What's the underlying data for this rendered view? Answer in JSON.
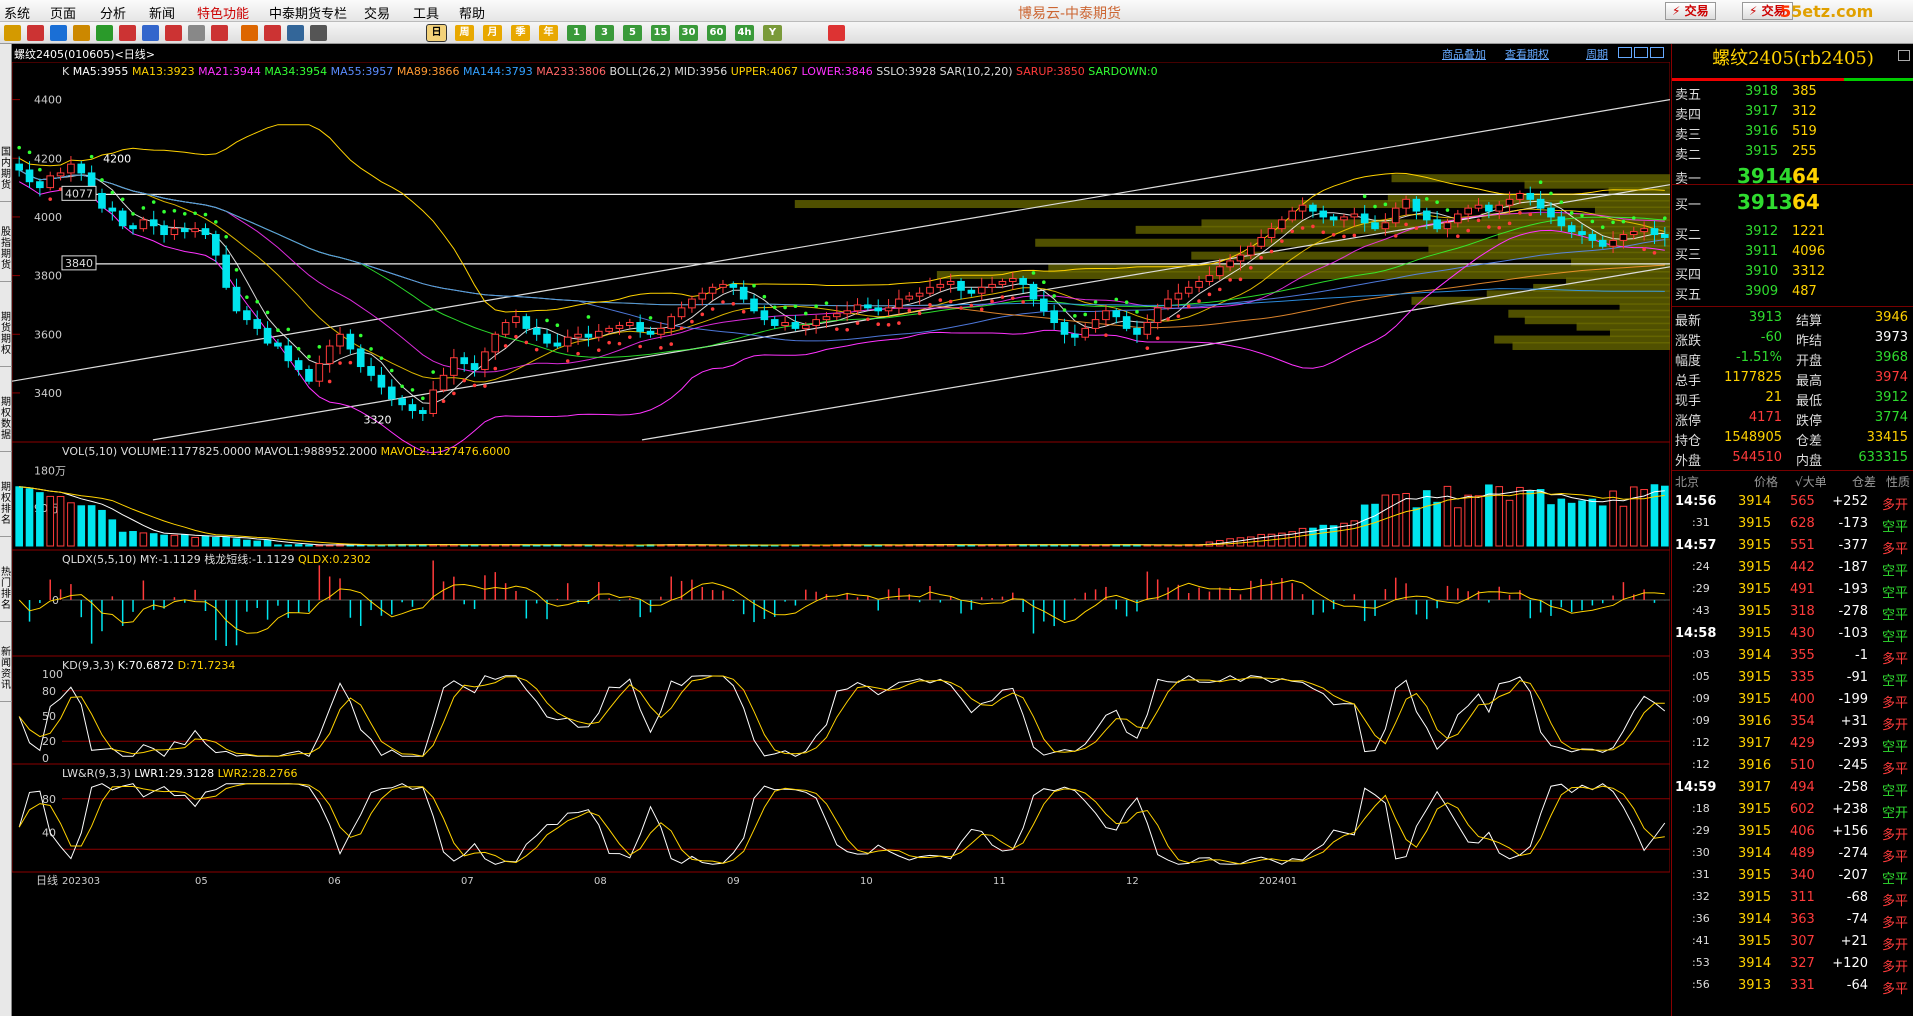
{
  "menu": {
    "items": [
      "系统",
      "页面",
      "分析",
      "新闻",
      "特色功能",
      "中泰期货专栏",
      "交易",
      "工具",
      "帮助"
    ],
    "app_title": "博易云-中泰期货",
    "trade_button": "交易",
    "trade_button2": "交易",
    "watermark_a": "5",
    "watermark_b": "5etz.com"
  },
  "toolbar": {
    "periods": [
      "日",
      "周",
      "月",
      "季",
      "年",
      "1",
      "3",
      "5",
      "15",
      "30",
      "60",
      "4h",
      "Y"
    ],
    "selected_period": "日"
  },
  "sidebar": {
    "tabs": [
      "国内期货",
      "股指期货",
      "期货期权",
      "期权数据",
      "期权排名",
      "热门排名",
      "新闻资讯"
    ]
  },
  "chart_header": {
    "symbol": "螺纹2405(010605)<日线>",
    "links": [
      "商品叠加",
      "查看期权",
      "周期"
    ]
  },
  "chart_data": [
    {
      "type": "candlestick",
      "panel": "main",
      "label": "K",
      "indicators": [
        {
          "name": "MA5",
          "value": "3955",
          "color": "#ffffff"
        },
        {
          "name": "MA13",
          "value": "3923",
          "color": "#ffd200"
        },
        {
          "name": "MA21",
          "value": "3944",
          "color": "#ff33ff"
        },
        {
          "name": "MA34",
          "value": "3954",
          "color": "#33ff33"
        },
        {
          "name": "MA55",
          "value": "3957",
          "color": "#5b8cff"
        },
        {
          "name": "MA89",
          "value": "3866",
          "color": "#ff9933"
        },
        {
          "name": "MA144",
          "value": "3793",
          "color": "#33a0ff"
        },
        {
          "name": "MA233",
          "value": "3806",
          "color": "#ff6666"
        },
        {
          "name": "BOLL(26,2)",
          "value": "",
          "color": "#dddddd"
        },
        {
          "name": "MID",
          "value": "3956",
          "color": "#dddddd"
        },
        {
          "name": "UPPER",
          "value": "4067",
          "color": "#ffd200"
        },
        {
          "name": "LOWER",
          "value": "3846",
          "color": "#ff33ff"
        },
        {
          "name": "SSLO",
          "value": "3928",
          "color": "#dddddd"
        },
        {
          "name": "SAR(10,2,20)",
          "value": "",
          "color": "#dddddd"
        },
        {
          "name": "SARUP",
          "value": "3850",
          "color": "#ff3b3b"
        },
        {
          "name": "SARDOWN",
          "value": "0",
          "color": "#33ff33"
        }
      ],
      "ylim": [
        3260,
        4460
      ],
      "y_ticks": [
        3400,
        3600,
        3800,
        4000,
        4200,
        4400
      ],
      "hlines": [
        4077,
        3840
      ],
      "annotations": [
        {
          "text": "4200",
          "x": 0.02,
          "y": 4200
        },
        {
          "text": "3320",
          "x": 0.177,
          "y": 3310
        },
        {
          "text": "4077",
          "x": 0.0,
          "y": 4077
        },
        {
          "text": "3840",
          "x": 0.0,
          "y": 3840
        }
      ],
      "closes": [
        4160,
        4120,
        4100,
        4140,
        4150,
        4180,
        4150,
        4080,
        4030,
        4020,
        3970,
        3960,
        3990,
        3970,
        3940,
        3960,
        3950,
        3960,
        3940,
        3870,
        3760,
        3680,
        3650,
        3620,
        3570,
        3560,
        3510,
        3480,
        3440,
        3500,
        3560,
        3600,
        3550,
        3490,
        3460,
        3420,
        3380,
        3360,
        3340,
        3330,
        3410,
        3460,
        3520,
        3500,
        3480,
        3540,
        3600,
        3640,
        3660,
        3620,
        3600,
        3570,
        3560,
        3590,
        3600,
        3590,
        3610,
        3620,
        3630,
        3640,
        3610,
        3600,
        3620,
        3660,
        3690,
        3720,
        3740,
        3760,
        3770,
        3760,
        3720,
        3680,
        3650,
        3630,
        3640,
        3620,
        3630,
        3650,
        3660,
        3670,
        3680,
        3700,
        3690,
        3680,
        3690,
        3720,
        3730,
        3740,
        3760,
        3770,
        3780,
        3750,
        3740,
        3760,
        3770,
        3780,
        3790,
        3770,
        3720,
        3680,
        3640,
        3600,
        3590,
        3620,
        3650,
        3680,
        3660,
        3620,
        3600,
        3640,
        3690,
        3720,
        3740,
        3760,
        3780,
        3800,
        3830,
        3850,
        3870,
        3900,
        3930,
        3960,
        3990,
        4020,
        4040,
        4020,
        4000,
        3990,
        4000,
        4010,
        3980,
        3960,
        3980,
        4030,
        4060,
        4020,
        3990,
        3960,
        3980,
        4010,
        4030,
        4040,
        4020,
        4040,
        4060,
        4080,
        4060,
        4030,
        4000,
        3970,
        3950,
        3940,
        3920,
        3900,
        3920,
        3940,
        3950,
        3960,
        3940,
        3930
      ],
      "channel_lines": [
        {
          "from": [
            0.0,
            3440
          ],
          "to": [
            1.0,
            4400
          ]
        },
        {
          "from": [
            0.085,
            3240
          ],
          "to": [
            1.0,
            4110
          ]
        },
        {
          "from": [
            0.38,
            3240
          ],
          "to": [
            1.0,
            3830
          ]
        }
      ]
    },
    {
      "type": "bar",
      "panel": "volume",
      "label": "VOL(5,10)",
      "indicators": [
        {
          "name": "VOLUME",
          "value": "1177825.0000",
          "color": "#dddddd"
        },
        {
          "name": "MAVOL1",
          "value": "988952.2000",
          "color": "#dddddd"
        },
        {
          "name": "MAVOL2",
          "value": "1127476.6000",
          "color": "#ffd200"
        }
      ],
      "y_ticks": [
        "180万",
        "90万"
      ],
      "ylim": [
        0,
        2000000
      ]
    },
    {
      "type": "macd",
      "panel": "qldx",
      "label": "QLDX(5,5,10)",
      "indicators": [
        {
          "name": "MY",
          "value": "-1.1129",
          "color": "#dddddd"
        },
        {
          "name": "栈龙短线",
          "value": "-1.1129",
          "color": "#dddddd"
        },
        {
          "name": "QLDX",
          "value": "0.2302",
          "color": "#ffd200"
        }
      ],
      "y_ticks": [
        "0"
      ]
    },
    {
      "type": "line",
      "panel": "kd",
      "label": "KD(9,3,3)",
      "indicators": [
        {
          "name": "K",
          "value": "70.6872",
          "color": "#ffffff"
        },
        {
          "name": "D",
          "value": "71.7234",
          "color": "#ffd200"
        }
      ],
      "ylim": [
        0,
        100
      ],
      "y_ticks": [
        0,
        20,
        50,
        80,
        100
      ]
    },
    {
      "type": "line",
      "panel": "lwr",
      "label": "LW&R(9,3,3)",
      "indicators": [
        {
          "name": "LWR1",
          "value": "29.3128",
          "color": "#ffffff"
        },
        {
          "name": "LWR2",
          "value": "28.2766",
          "color": "#ffd200"
        }
      ],
      "ylim": [
        0,
        100
      ],
      "y_ticks": [
        40,
        80
      ]
    }
  ],
  "x_axis": {
    "label": "日线",
    "ticks": [
      "202303",
      "05",
      "06",
      "07",
      "08",
      "09",
      "10",
      "11",
      "12",
      "202401"
    ]
  },
  "quote": {
    "title": "螺纹2405(rb2405)",
    "asks": [
      {
        "label": "卖五",
        "price": "3918",
        "vol": "385"
      },
      {
        "label": "卖四",
        "price": "3917",
        "vol": "312"
      },
      {
        "label": "卖三",
        "price": "3916",
        "vol": "519"
      },
      {
        "label": "卖二",
        "price": "3915",
        "vol": "255"
      },
      {
        "label": "卖一",
        "price": "3914",
        "vol": "64"
      }
    ],
    "bids": [
      {
        "label": "买一",
        "price": "3913",
        "vol": "64"
      },
      {
        "label": "买二",
        "price": "3912",
        "vol": "1221"
      },
      {
        "label": "买三",
        "price": "3911",
        "vol": "4096"
      },
      {
        "label": "买四",
        "price": "3910",
        "vol": "3312"
      },
      {
        "label": "买五",
        "price": "3909",
        "vol": "487"
      }
    ],
    "stats": [
      {
        "l1": "最新",
        "v1": "3913",
        "c1": "grn",
        "l2": "结算",
        "v2": "3946",
        "c2": "yel"
      },
      {
        "l1": "涨跌",
        "v1": "-60",
        "c1": "grn",
        "l2": "昨结",
        "v2": "3973",
        "c2": "wht"
      },
      {
        "l1": "幅度",
        "v1": "-1.51%",
        "c1": "grn",
        "l2": "开盘",
        "v2": "3968",
        "c2": "grn"
      },
      {
        "l1": "总手",
        "v1": "1177825",
        "c1": "yel",
        "l2": "最高",
        "v2": "3974",
        "c2": "red"
      },
      {
        "l1": "现手",
        "v1": "21",
        "c1": "yel",
        "l2": "最低",
        "v2": "3912",
        "c2": "grn"
      },
      {
        "l1": "涨停",
        "v1": "4171",
        "c1": "red",
        "l2": "跌停",
        "v2": "3774",
        "c2": "grn"
      },
      {
        "l1": "持仓",
        "v1": "1548905",
        "c1": "yel",
        "l2": "仓差",
        "v2": "33415",
        "c2": "yel"
      },
      {
        "l1": "外盘",
        "v1": "544510",
        "c1": "red",
        "l2": "内盘",
        "v2": "633315",
        "c2": "grn"
      }
    ],
    "ticks_header": [
      "北京",
      "价格",
      "√大单",
      "仓差",
      "性质"
    ],
    "ticks": [
      {
        "time": "14:56",
        "price": "3914",
        "vol": "565",
        "diff": "+252",
        "type": "多开",
        "major": true
      },
      {
        "time": ":31",
        "price": "3915",
        "vol": "628",
        "diff": "-173",
        "type": "空平",
        "major": false
      },
      {
        "time": "14:57",
        "price": "3915",
        "vol": "551",
        "diff": "-377",
        "type": "多平",
        "major": true
      },
      {
        "time": ":24",
        "price": "3915",
        "vol": "442",
        "diff": "-187",
        "type": "空平",
        "major": false
      },
      {
        "time": ":29",
        "price": "3915",
        "vol": "491",
        "diff": "-193",
        "type": "空平",
        "major": false
      },
      {
        "time": ":43",
        "price": "3915",
        "vol": "318",
        "diff": "-278",
        "type": "空平",
        "major": false
      },
      {
        "time": "14:58",
        "price": "3915",
        "vol": "430",
        "diff": "-103",
        "type": "空平",
        "major": true
      },
      {
        "time": ":03",
        "price": "3914",
        "vol": "355",
        "diff": "-1",
        "type": "多平",
        "major": false
      },
      {
        "time": ":05",
        "price": "3915",
        "vol": "335",
        "diff": "-91",
        "type": "空平",
        "major": false
      },
      {
        "time": ":09",
        "price": "3915",
        "vol": "400",
        "diff": "-199",
        "type": "多平",
        "major": false
      },
      {
        "time": ":09",
        "price": "3916",
        "vol": "354",
        "diff": "+31",
        "type": "多开",
        "major": false
      },
      {
        "time": ":12",
        "price": "3917",
        "vol": "429",
        "diff": "-293",
        "type": "空平",
        "major": false
      },
      {
        "time": ":12",
        "price": "3916",
        "vol": "510",
        "diff": "-245",
        "type": "多平",
        "major": false
      },
      {
        "time": "14:59",
        "price": "3917",
        "vol": "494",
        "diff": "-258",
        "type": "空平",
        "major": true
      },
      {
        "time": ":18",
        "price": "3915",
        "vol": "602",
        "diff": "+238",
        "type": "空开",
        "major": false
      },
      {
        "time": ":29",
        "price": "3915",
        "vol": "406",
        "diff": "+156",
        "type": "多开",
        "major": false
      },
      {
        "time": ":30",
        "price": "3914",
        "vol": "489",
        "diff": "-274",
        "type": "多平",
        "major": false
      },
      {
        "time": ":31",
        "price": "3915",
        "vol": "340",
        "diff": "-207",
        "type": "空平",
        "major": false
      },
      {
        "time": ":32",
        "price": "3915",
        "vol": "311",
        "diff": "-68",
        "type": "多平",
        "major": false
      },
      {
        "time": ":36",
        "price": "3914",
        "vol": "363",
        "diff": "-74",
        "type": "多平",
        "major": false
      },
      {
        "time": ":41",
        "price": "3915",
        "vol": "307",
        "diff": "+21",
        "type": "多开",
        "major": false
      },
      {
        "time": ":53",
        "price": "3914",
        "vol": "327",
        "diff": "+120",
        "type": "多开",
        "major": false
      },
      {
        "time": ":56",
        "price": "3913",
        "vol": "331",
        "diff": "-64",
        "type": "多平",
        "major": false
      }
    ]
  }
}
